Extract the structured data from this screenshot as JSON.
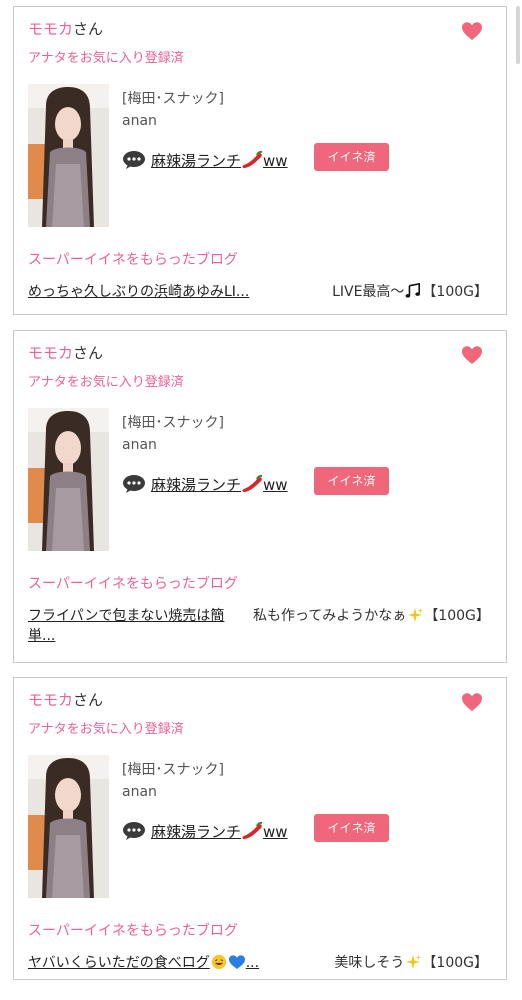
{
  "colors": {
    "accent_pink": "#f0609a",
    "badge_pink": "#f0677c",
    "border": "#c9c9c9"
  },
  "cards": [
    {
      "user_name": "モモカ",
      "honorific": "さん",
      "favorite_status": "アナタをお気に入り登録済",
      "shop_label": "[梅田･スナック]",
      "shop_name": "anan",
      "post_title_pre": "麻辣湯ランチ",
      "post_title_post": "ww",
      "like_badge": "イイネ済",
      "blog_heading": "スーパーイイネをもらったブログ",
      "blog_link": "めっちゃ久しぶりの浜崎あゆみLI...",
      "blog_comment_pre": "LIVE最高～",
      "blog_comment_post": "【100G】",
      "blog_comment_emoji": "musical-notes-emoji"
    },
    {
      "user_name": "モモカ",
      "honorific": "さん",
      "favorite_status": "アナタをお気に入り登録済",
      "shop_label": "[梅田･スナック]",
      "shop_name": "anan",
      "post_title_pre": "麻辣湯ランチ",
      "post_title_post": "ww",
      "like_badge": "イイネ済",
      "blog_heading": "スーパーイイネをもらったブログ",
      "blog_link": "フライパンで包まない焼売は簡単...",
      "blog_comment_pre": "私も作ってみようかなぁ",
      "blog_comment_post": "【100G】",
      "blog_comment_emoji": "sparkles-emoji"
    },
    {
      "user_name": "モモカ",
      "honorific": "さん",
      "favorite_status": "アナタをお気に入り登録済",
      "shop_label": "[梅田･スナック]",
      "shop_name": "anan",
      "post_title_pre": "麻辣湯ランチ",
      "post_title_post": "ww",
      "like_badge": "イイネ済",
      "blog_heading": "スーパーイイネをもらったブログ",
      "blog_link_pre": "ヤバいくらいただの食べログ",
      "blog_link_post": "...",
      "blog_comment_pre": "美味しそう",
      "blog_comment_post": "【100G】",
      "blog_comment_emoji": "sparkles-emoji"
    }
  ]
}
